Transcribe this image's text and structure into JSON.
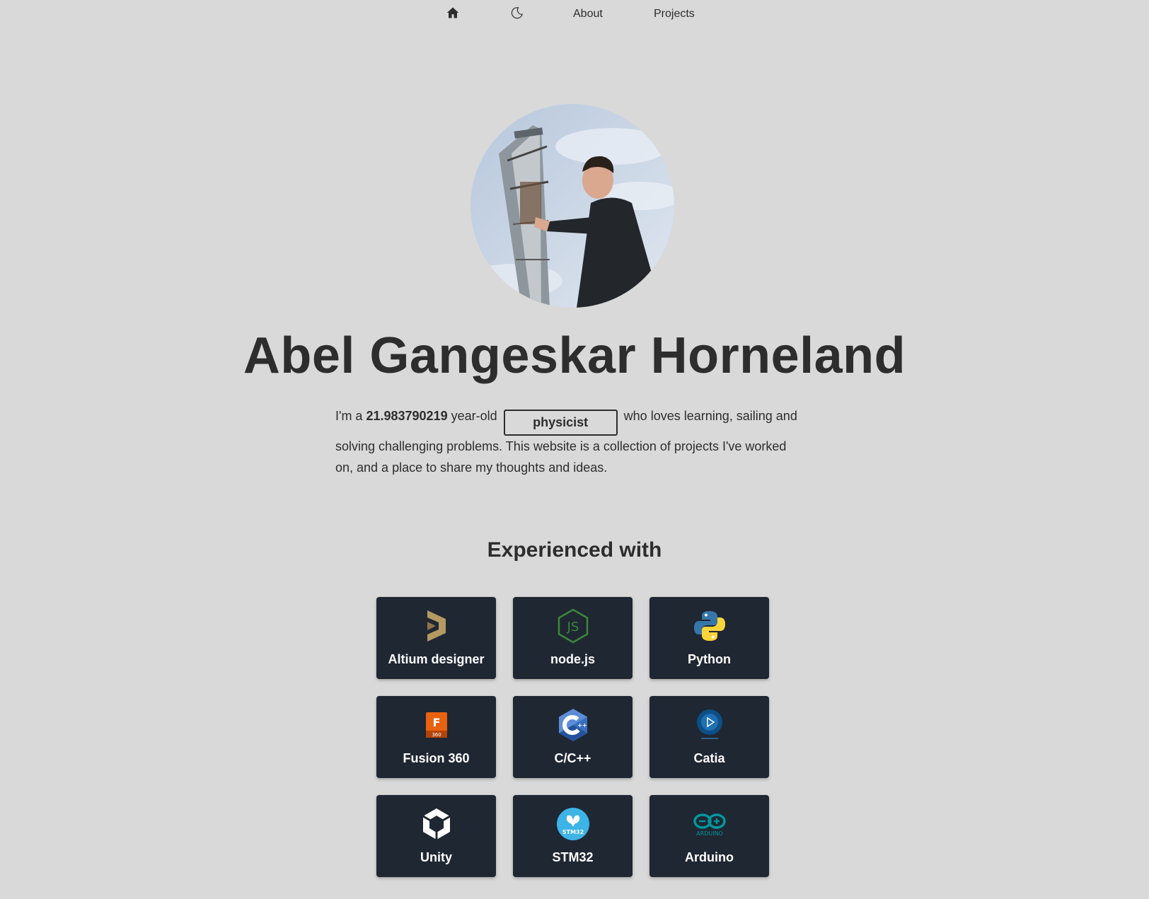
{
  "nav": {
    "home_icon": "home-icon",
    "theme_icon": "moon-icon",
    "about_label": "About",
    "projects_label": "Projects"
  },
  "hero": {
    "name": "Abel Gangeskar Horneland",
    "intro_prefix": "I'm a",
    "age": "21.983790219",
    "age_suffix": "year-old",
    "role": "physicist",
    "intro_rest": "who loves learning, sailing and solving challenging problems. This website is a collection of projects I've worked on, and a place to share my thoughts and ideas."
  },
  "skills": {
    "title": "Experienced with",
    "items": [
      {
        "label": "Altium designer",
        "icon": "altium-icon"
      },
      {
        "label": "node.js",
        "icon": "nodejs-icon"
      },
      {
        "label": "Python",
        "icon": "python-icon"
      },
      {
        "label": "Fusion 360",
        "icon": "fusion360-icon"
      },
      {
        "label": "C/C++",
        "icon": "cpp-icon"
      },
      {
        "label": "Catia",
        "icon": "catia-icon"
      },
      {
        "label": "Unity",
        "icon": "unity-icon"
      },
      {
        "label": "STM32",
        "icon": "stm32-icon"
      },
      {
        "label": "Arduino",
        "icon": "arduino-icon"
      }
    ],
    "icon_text": {
      "fusion": "F",
      "fusion_sub": "360",
      "stm32": "STM32",
      "arduino": "ARDUINO"
    }
  },
  "colors": {
    "background": "#d9d9d9",
    "text": "#2d2d2d",
    "card": "#1f2733",
    "card_text": "#ffffff"
  }
}
